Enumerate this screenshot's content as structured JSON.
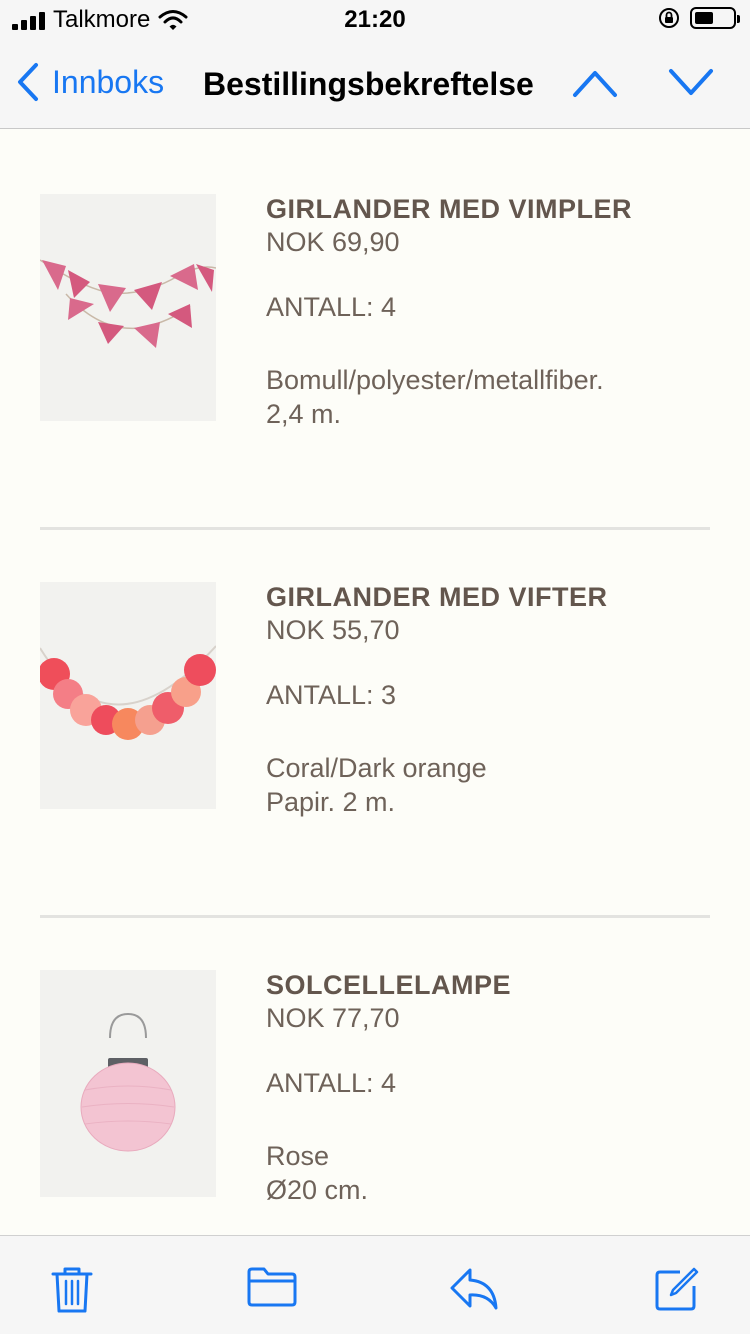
{
  "status_bar": {
    "carrier": "Talkmore",
    "time": "21:20"
  },
  "nav": {
    "back_label": "Innboks",
    "title": "Bestillingsbekreftelse"
  },
  "items": [
    {
      "name": "GIRLANDER MED VIMPLER",
      "price": "NOK 69,90",
      "quantity": "ANTALL: 4",
      "desc_line1": "Bomull/polyester/metallfiber.",
      "desc_line2": "2,4 m."
    },
    {
      "name": "GIRLANDER MED VIFTER",
      "price": "NOK 55,70",
      "quantity": "ANTALL: 3",
      "desc_line1": "Coral/Dark orange",
      "desc_line2": "Papir. 2 m."
    },
    {
      "name": "SOLCELLELAMPE",
      "price": "NOK 77,70",
      "quantity": "ANTALL: 4",
      "desc_line1": "Rose",
      "desc_line2": "Ø20 cm."
    }
  ],
  "toolbar": {
    "icons": [
      "trash-icon",
      "folder-icon",
      "reply-icon",
      "compose-icon"
    ]
  },
  "colors": {
    "accent": "#1877f2",
    "text": "#6e6259",
    "background": "#fdfdf8"
  }
}
